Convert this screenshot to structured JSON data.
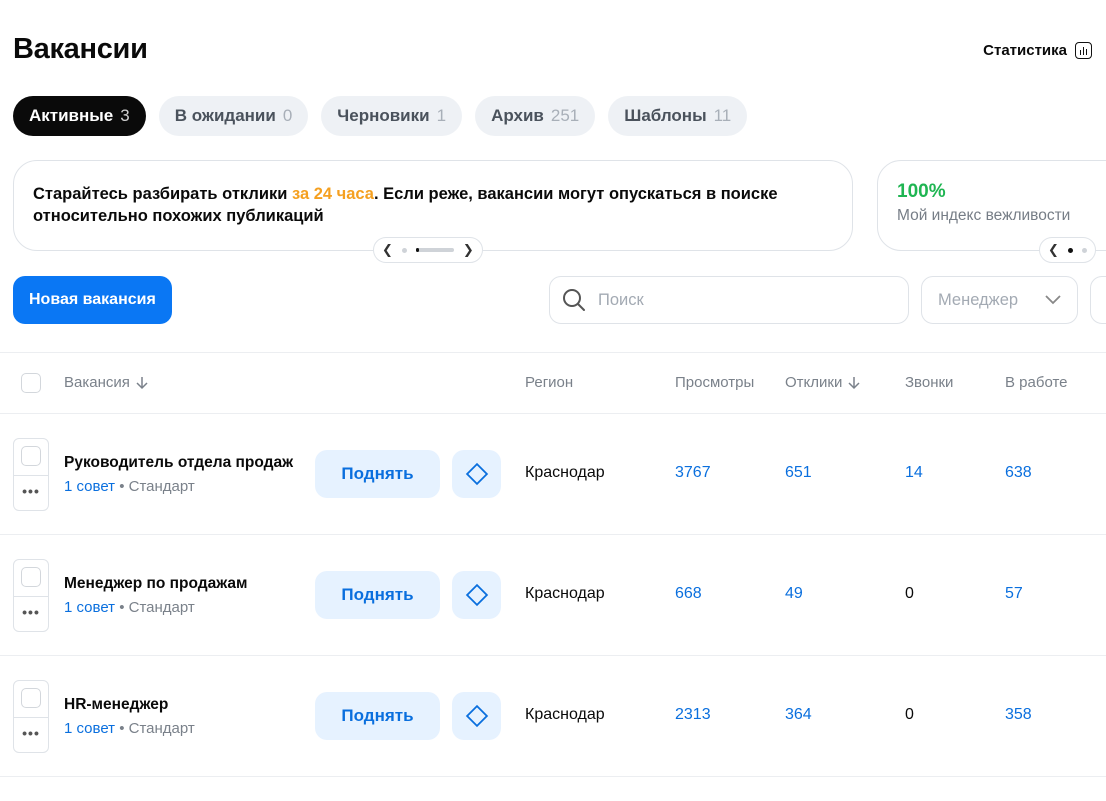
{
  "header": {
    "title": "Вакансии",
    "stats_label": "Статистика"
  },
  "tabs": [
    {
      "label": "Активные",
      "count": "3"
    },
    {
      "label": "В ожидании",
      "count": "0"
    },
    {
      "label": "Черновики",
      "count": "1"
    },
    {
      "label": "Архив",
      "count": "251"
    },
    {
      "label": "Шаблоны",
      "count": "11"
    }
  ],
  "banner": {
    "text_before": "Старайтесь разбирать отклики ",
    "highlight": "за 24 часа",
    "text_after": ". Если реже, вакансии могут опускаться в поиске относительно похожих публикаций",
    "highlight_color": "#f5a020"
  },
  "politeness": {
    "value": "100%",
    "label": "Мой индекс вежливости",
    "color": "#1fb552"
  },
  "toolbar": {
    "new_vacancy_label": "Новая вакансия",
    "search_placeholder": "Поиск",
    "manager_label": "Менеджер"
  },
  "columns": {
    "vacancy": "Вакансия",
    "region": "Регион",
    "views": "Просмотры",
    "responses": "Отклики",
    "calls": "Звонки",
    "in_work": "В работе"
  },
  "rows": [
    {
      "title": "Руководитель отдела продаж",
      "tip": "1 совет",
      "plan": "Стандарт",
      "raise": "Поднять",
      "region": "Краснодар",
      "views": "3767",
      "responses": "651",
      "calls": "14",
      "in_work": "638"
    },
    {
      "title": "Менеджер по продажам",
      "tip": "1 совет",
      "plan": "Стандарт",
      "raise": "Поднять",
      "region": "Краснодар",
      "views": "668",
      "responses": "49",
      "calls": "0",
      "in_work": "57"
    },
    {
      "title": "HR-менеджер",
      "tip": "1 совет",
      "plan": "Стандарт",
      "raise": "Поднять",
      "region": "Краснодар",
      "views": "2313",
      "responses": "364",
      "calls": "0",
      "in_work": "358"
    }
  ],
  "colors": {
    "accent": "#0a77f4",
    "link": "#0a6fde",
    "active_tab": "#0a0a0a"
  },
  "icons": [
    "stats-icon",
    "search-icon",
    "chevron-down-icon",
    "sort-arrow-icon",
    "diamond-icon",
    "more-icon",
    "arrow-left-icon",
    "arrow-right-icon"
  ]
}
